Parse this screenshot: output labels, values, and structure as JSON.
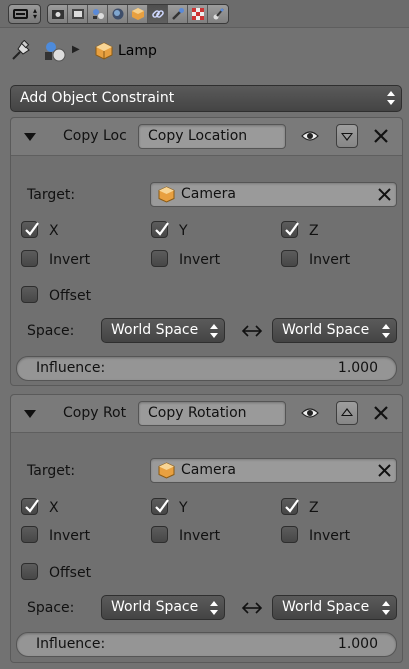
{
  "header": {
    "tabs": [
      {
        "icon": "render-icon",
        "active": false
      },
      {
        "icon": "render-layers-icon",
        "active": false
      },
      {
        "icon": "scene-icon",
        "active": false
      },
      {
        "icon": "world-icon",
        "active": false
      },
      {
        "icon": "object-icon",
        "active": false
      },
      {
        "icon": "constraints-icon",
        "active": true
      },
      {
        "icon": "modifiers-icon",
        "active": false
      },
      {
        "icon": "texture-icon",
        "active": false
      },
      {
        "icon": "physics-icon",
        "active": false
      }
    ]
  },
  "breadcrumb": {
    "object_name": "Lamp"
  },
  "add_constraint": {
    "label": "Add Object Constraint"
  },
  "constraints": [
    {
      "type_label": "Copy Loc",
      "name": "Copy Location",
      "target_label": "Target:",
      "target": "Camera",
      "axes": [
        {
          "label": "X",
          "checked": true
        },
        {
          "label": "Y",
          "checked": true
        },
        {
          "label": "Z",
          "checked": true
        }
      ],
      "invert": [
        {
          "label": "Invert",
          "checked": false
        },
        {
          "label": "Invert",
          "checked": false
        },
        {
          "label": "Invert",
          "checked": false
        }
      ],
      "offset": {
        "label": "Offset",
        "checked": false
      },
      "space_label": "Space:",
      "owner_space": "World Space",
      "target_space": "World Space",
      "influence_label": "Influence:",
      "influence": "1.000"
    },
    {
      "type_label": "Copy Rot",
      "name": "Copy Rotation",
      "target_label": "Target:",
      "target": "Camera",
      "axes": [
        {
          "label": "X",
          "checked": true
        },
        {
          "label": "Y",
          "checked": true
        },
        {
          "label": "Z",
          "checked": true
        }
      ],
      "invert": [
        {
          "label": "Invert",
          "checked": false
        },
        {
          "label": "Invert",
          "checked": false
        },
        {
          "label": "Invert",
          "checked": false
        }
      ],
      "offset": {
        "label": "Offset",
        "checked": false
      },
      "space_label": "Space:",
      "owner_space": "World Space",
      "target_space": "World Space",
      "influence_label": "Influence:",
      "influence": "1.000"
    }
  ],
  "colors": {
    "background": "#727272",
    "button_dark": "#4a4a4a",
    "field_light": "#9a9a9a",
    "cube_orange": "#e8a040"
  }
}
